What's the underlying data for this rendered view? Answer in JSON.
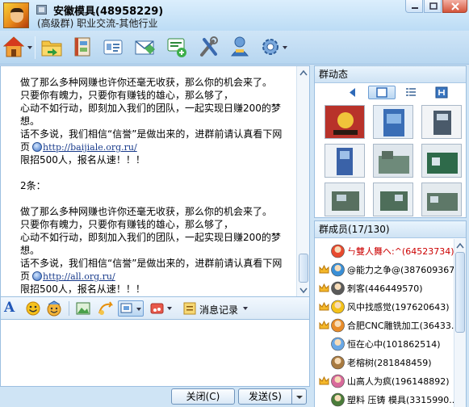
{
  "window": {
    "title": "安徽模具(48958229)",
    "subtitle": "(高级群) 职业交流-其他行业"
  },
  "toolbar": {
    "items": [
      {
        "icon": "home-icon"
      },
      {
        "icon": "folder-share-icon"
      },
      {
        "icon": "album-icon"
      },
      {
        "icon": "group-card-icon"
      },
      {
        "icon": "mail-icon"
      },
      {
        "icon": "forum-icon"
      },
      {
        "icon": "tools-icon"
      },
      {
        "icon": "member-manage-icon"
      },
      {
        "icon": "settings-icon"
      }
    ]
  },
  "chat": {
    "lines": [
      "做了那么多种网赚也许你还毫无收获，那么你的机会来了。",
      "只要你有魄力，只要你有赚钱的雄心，那么够了，",
      "心动不如行动，即刻加入我们的团队，一起实现日赚200的梦",
      "想。",
      "话不多说，我们相信“信誉”是做出来的，进群前请认真看下网",
      "页",
      "http://baijiale.org.ru/",
      "限招500人，报名从速！！！",
      "2条：",
      "做了那么多种网赚也许你还毫无收获，那么你的机会来了。",
      "只要你有魄力，只要你有赚钱的雄心，那么够了，",
      "心动不如行动，即刻加入我们的团队，一起实现日赚200的梦",
      "想。",
      "话不多说，我们相信“信誉”是做出来的，进群前请认真看下网",
      "页",
      "http://all.org.ru/",
      "限招500人，报名从速！！！"
    ]
  },
  "input_toolbar": {
    "font_label": "A",
    "history_label": "消息记录"
  },
  "input": {
    "value": ""
  },
  "buttons": {
    "close": "关闭(C)",
    "send": "发送(S)"
  },
  "group_dynamics": {
    "title": "群动态"
  },
  "members": {
    "title": "群成员(17/130)",
    "list": [
      {
        "name": "ㄣ雙人舞ヘ:^(64523734)",
        "color": "#cc0000",
        "admin": false,
        "avatar": "#e84a2f"
      },
      {
        "name": "@能力之争@(387609367)",
        "color": "#000000",
        "admin": true,
        "avatar": "#3a8fd6"
      },
      {
        "name": "刺客(446449570)",
        "color": "#000000",
        "admin": true,
        "avatar": "#5a5a5a"
      },
      {
        "name": "风中找感觉(197620643)",
        "color": "#000000",
        "admin": true,
        "avatar": "#f4c21a"
      },
      {
        "name": "合肥CNC雕铣加工(36433...",
        "color": "#000000",
        "admin": true,
        "avatar": "#e88c2a"
      },
      {
        "name": "恒在心中(101862514)",
        "color": "#000000",
        "admin": false,
        "avatar": "#6aa8e6"
      },
      {
        "name": "老榕树(281848459)",
        "color": "#000000",
        "admin": false,
        "avatar": "#a87a40"
      },
      {
        "name": "山高人为疯(196148892)",
        "color": "#000000",
        "admin": true,
        "avatar": "#d86a9c"
      },
      {
        "name": "塑料 压铸 模具(3315990...",
        "color": "#000000",
        "admin": false,
        "avatar": "#4a7c3a"
      }
    ]
  },
  "colors": {
    "accent": "#2057b8",
    "link": "#1a3c8c",
    "owner_name": "#cc0000",
    "panel_border": "#9cbfe0"
  }
}
